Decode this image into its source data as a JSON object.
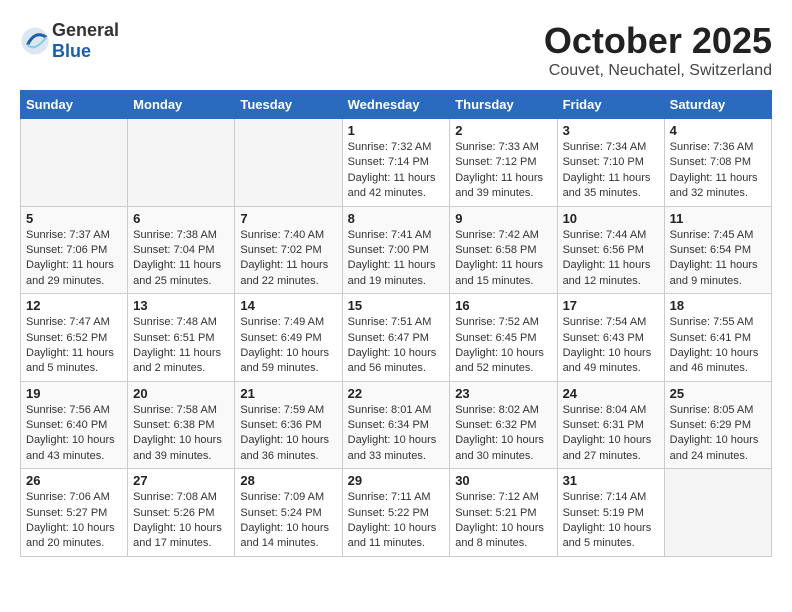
{
  "header": {
    "logo_general": "General",
    "logo_blue": "Blue",
    "month": "October 2025",
    "location": "Couvet, Neuchatel, Switzerland"
  },
  "days_of_week": [
    "Sunday",
    "Monday",
    "Tuesday",
    "Wednesday",
    "Thursday",
    "Friday",
    "Saturday"
  ],
  "weeks": [
    [
      {
        "day": "",
        "empty": true
      },
      {
        "day": "",
        "empty": true
      },
      {
        "day": "",
        "empty": true
      },
      {
        "day": "1",
        "sunrise": "7:32 AM",
        "sunset": "7:14 PM",
        "daylight": "11 hours and 42 minutes."
      },
      {
        "day": "2",
        "sunrise": "7:33 AM",
        "sunset": "7:12 PM",
        "daylight": "11 hours and 39 minutes."
      },
      {
        "day": "3",
        "sunrise": "7:34 AM",
        "sunset": "7:10 PM",
        "daylight": "11 hours and 35 minutes."
      },
      {
        "day": "4",
        "sunrise": "7:36 AM",
        "sunset": "7:08 PM",
        "daylight": "11 hours and 32 minutes."
      }
    ],
    [
      {
        "day": "5",
        "sunrise": "7:37 AM",
        "sunset": "7:06 PM",
        "daylight": "11 hours and 29 minutes."
      },
      {
        "day": "6",
        "sunrise": "7:38 AM",
        "sunset": "7:04 PM",
        "daylight": "11 hours and 25 minutes."
      },
      {
        "day": "7",
        "sunrise": "7:40 AM",
        "sunset": "7:02 PM",
        "daylight": "11 hours and 22 minutes."
      },
      {
        "day": "8",
        "sunrise": "7:41 AM",
        "sunset": "7:00 PM",
        "daylight": "11 hours and 19 minutes."
      },
      {
        "day": "9",
        "sunrise": "7:42 AM",
        "sunset": "6:58 PM",
        "daylight": "11 hours and 15 minutes."
      },
      {
        "day": "10",
        "sunrise": "7:44 AM",
        "sunset": "6:56 PM",
        "daylight": "11 hours and 12 minutes."
      },
      {
        "day": "11",
        "sunrise": "7:45 AM",
        "sunset": "6:54 PM",
        "daylight": "11 hours and 9 minutes."
      }
    ],
    [
      {
        "day": "12",
        "sunrise": "7:47 AM",
        "sunset": "6:52 PM",
        "daylight": "11 hours and 5 minutes."
      },
      {
        "day": "13",
        "sunrise": "7:48 AM",
        "sunset": "6:51 PM",
        "daylight": "11 hours and 2 minutes."
      },
      {
        "day": "14",
        "sunrise": "7:49 AM",
        "sunset": "6:49 PM",
        "daylight": "10 hours and 59 minutes."
      },
      {
        "day": "15",
        "sunrise": "7:51 AM",
        "sunset": "6:47 PM",
        "daylight": "10 hours and 56 minutes."
      },
      {
        "day": "16",
        "sunrise": "7:52 AM",
        "sunset": "6:45 PM",
        "daylight": "10 hours and 52 minutes."
      },
      {
        "day": "17",
        "sunrise": "7:54 AM",
        "sunset": "6:43 PM",
        "daylight": "10 hours and 49 minutes."
      },
      {
        "day": "18",
        "sunrise": "7:55 AM",
        "sunset": "6:41 PM",
        "daylight": "10 hours and 46 minutes."
      }
    ],
    [
      {
        "day": "19",
        "sunrise": "7:56 AM",
        "sunset": "6:40 PM",
        "daylight": "10 hours and 43 minutes."
      },
      {
        "day": "20",
        "sunrise": "7:58 AM",
        "sunset": "6:38 PM",
        "daylight": "10 hours and 39 minutes."
      },
      {
        "day": "21",
        "sunrise": "7:59 AM",
        "sunset": "6:36 PM",
        "daylight": "10 hours and 36 minutes."
      },
      {
        "day": "22",
        "sunrise": "8:01 AM",
        "sunset": "6:34 PM",
        "daylight": "10 hours and 33 minutes."
      },
      {
        "day": "23",
        "sunrise": "8:02 AM",
        "sunset": "6:32 PM",
        "daylight": "10 hours and 30 minutes."
      },
      {
        "day": "24",
        "sunrise": "8:04 AM",
        "sunset": "6:31 PM",
        "daylight": "10 hours and 27 minutes."
      },
      {
        "day": "25",
        "sunrise": "8:05 AM",
        "sunset": "6:29 PM",
        "daylight": "10 hours and 24 minutes."
      }
    ],
    [
      {
        "day": "26",
        "sunrise": "7:06 AM",
        "sunset": "5:27 PM",
        "daylight": "10 hours and 20 minutes."
      },
      {
        "day": "27",
        "sunrise": "7:08 AM",
        "sunset": "5:26 PM",
        "daylight": "10 hours and 17 minutes."
      },
      {
        "day": "28",
        "sunrise": "7:09 AM",
        "sunset": "5:24 PM",
        "daylight": "10 hours and 14 minutes."
      },
      {
        "day": "29",
        "sunrise": "7:11 AM",
        "sunset": "5:22 PM",
        "daylight": "10 hours and 11 minutes."
      },
      {
        "day": "30",
        "sunrise": "7:12 AM",
        "sunset": "5:21 PM",
        "daylight": "10 hours and 8 minutes."
      },
      {
        "day": "31",
        "sunrise": "7:14 AM",
        "sunset": "5:19 PM",
        "daylight": "10 hours and 5 minutes."
      },
      {
        "day": "",
        "empty": true
      }
    ]
  ]
}
